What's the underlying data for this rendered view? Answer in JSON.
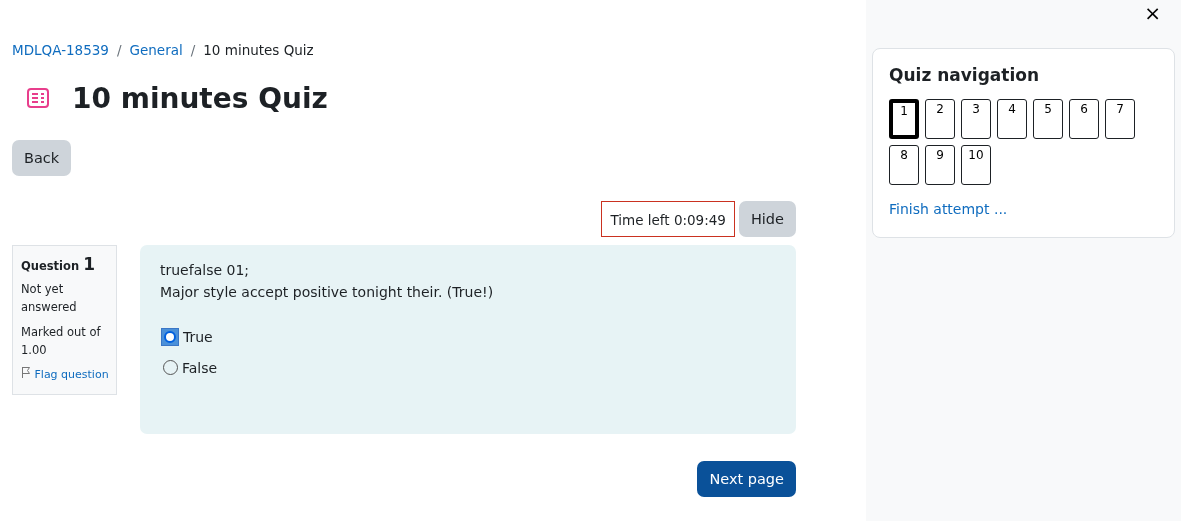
{
  "breadcrumb": [
    {
      "label": "MDLQA-18539",
      "link": true
    },
    {
      "label": "General",
      "link": true
    },
    {
      "label": "10 minutes Quiz",
      "link": false
    }
  ],
  "separator": "/",
  "title": "10 minutes Quiz",
  "back_button": "Back",
  "timer": {
    "text": "Time left 0:09:49"
  },
  "hide_button": "Hide",
  "question_info": {
    "label": "Question",
    "number": "1",
    "status": "Not yet answered",
    "marks": "Marked out of 1.00",
    "flag": "Flag question"
  },
  "question": {
    "lines": [
      "truefalse 01;",
      "Major style accept positive tonight their. (True!)"
    ],
    "options": [
      {
        "label": "True",
        "selected": true
      },
      {
        "label": "False",
        "selected": false
      }
    ]
  },
  "next_button": "Next page",
  "close": "×",
  "navigation": {
    "title": "Quiz navigation",
    "questions": [
      {
        "label": "1",
        "selected": true
      },
      {
        "label": "2",
        "selected": false
      },
      {
        "label": "3",
        "selected": false
      },
      {
        "label": "4",
        "selected": false
      },
      {
        "label": "5",
        "selected": false
      },
      {
        "label": "6",
        "selected": false
      },
      {
        "label": "7",
        "selected": false
      },
      {
        "label": "8",
        "selected": false
      },
      {
        "label": "9",
        "selected": false
      },
      {
        "label": "10",
        "selected": false
      }
    ],
    "finish": "Finish attempt ..."
  }
}
